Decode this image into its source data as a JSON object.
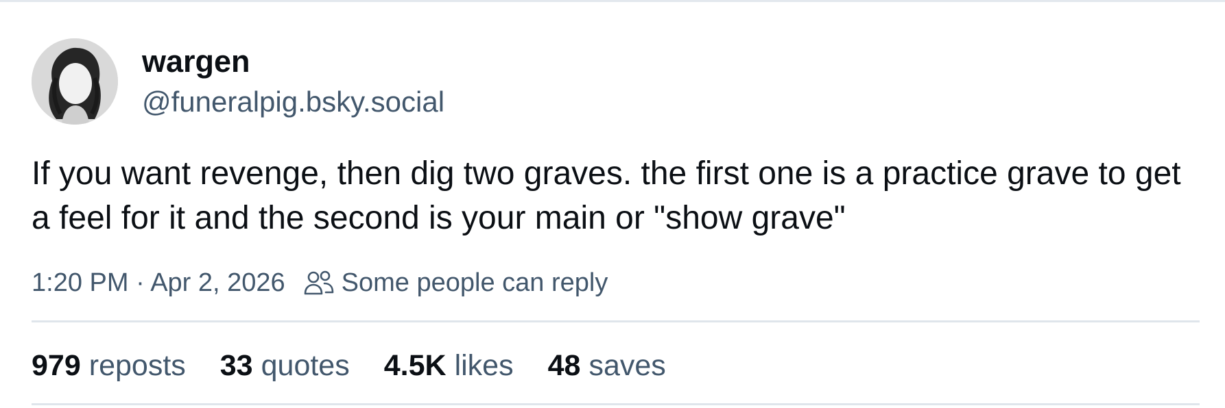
{
  "author": {
    "display_name": "wargen",
    "handle": "@funeralpig.bsky.social",
    "avatar_icon": "avatar-portrait"
  },
  "post": {
    "text": "If you want revenge, then dig two graves. the first one is a practice grave to get a feel for it and the second is your main or \"show grave\""
  },
  "meta": {
    "timestamp": "1:20 PM · Apr 2, 2026",
    "reply_icon": "people-icon",
    "reply_setting": "Some people can reply"
  },
  "stats": {
    "reposts": {
      "count": "979",
      "label": "reposts"
    },
    "quotes": {
      "count": "33",
      "label": "quotes"
    },
    "likes": {
      "count": "4.5K",
      "label": "likes"
    },
    "saves": {
      "count": "48",
      "label": "saves"
    }
  },
  "colors": {
    "text_primary": "#0b0f14",
    "text_secondary": "#42576c",
    "divider": "#dfe5eb"
  }
}
